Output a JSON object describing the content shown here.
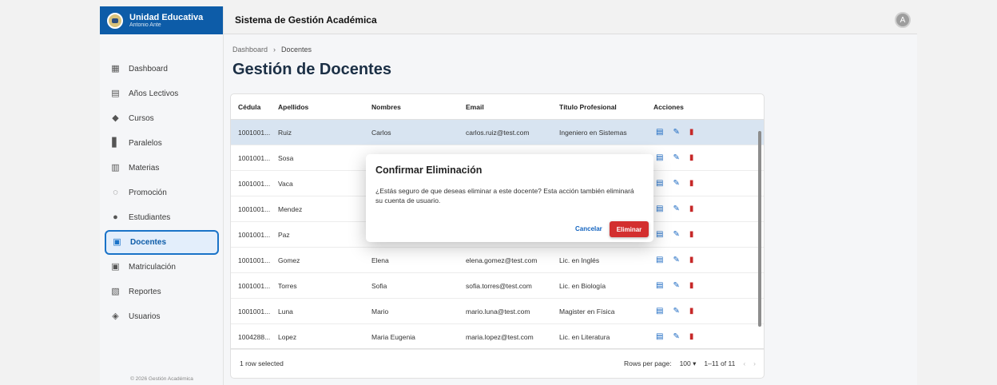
{
  "brand": {
    "title": "Unidad Educativa",
    "subtitle": "Antonio Ante"
  },
  "header": {
    "title": "Sistema de Gestión Académica",
    "avatar_letter": "A"
  },
  "sidebar": {
    "items": [
      {
        "label": "Dashboard",
        "icon": "dashboard-icon",
        "glyph": "▦"
      },
      {
        "label": "Años Lectivos",
        "icon": "calendar-icon",
        "glyph": "▤"
      },
      {
        "label": "Cursos",
        "icon": "school-icon",
        "glyph": "◆"
      },
      {
        "label": "Paralelos",
        "icon": "class-icon",
        "glyph": "▋"
      },
      {
        "label": "Materias",
        "icon": "book-icon",
        "glyph": "▥"
      },
      {
        "label": "Promoción",
        "icon": "promotion-icon",
        "glyph": "◌"
      },
      {
        "label": "Estudiantes",
        "icon": "person-icon",
        "glyph": "●"
      },
      {
        "label": "Docentes",
        "icon": "teacher-icon",
        "glyph": "▣",
        "active": true
      },
      {
        "label": "Matriculación",
        "icon": "badge-icon",
        "glyph": "▣"
      },
      {
        "label": "Reportes",
        "icon": "chart-icon",
        "glyph": "▧"
      },
      {
        "label": "Usuarios",
        "icon": "users-icon",
        "glyph": "◈"
      }
    ],
    "footer": "© 2026 Gestión Académica"
  },
  "breadcrumb": {
    "parent": "Dashboard",
    "separator": "›",
    "current": "Docentes"
  },
  "page": {
    "title": "Gestión de Docentes"
  },
  "table": {
    "columns": [
      "Cédula",
      "Apellidos",
      "Nombres",
      "Email",
      "Título Profesional",
      "Acciones"
    ],
    "rows": [
      {
        "cedula": "1001001...",
        "apellidos": "Ruiz",
        "nombres": "Carlos",
        "email": "carlos.ruiz@test.com",
        "titulo": "Ingeniero en Sistemas",
        "selected": true
      },
      {
        "cedula": "1001001...",
        "apellidos": "Sosa",
        "nombres": "",
        "email": "",
        "titulo": ""
      },
      {
        "cedula": "1001001...",
        "apellidos": "Vaca",
        "nombres": "",
        "email": "",
        "titulo": ""
      },
      {
        "cedula": "1001001...",
        "apellidos": "Mendez",
        "nombres": "",
        "email": "",
        "titulo": ""
      },
      {
        "cedula": "1001001...",
        "apellidos": "Paz",
        "nombres": "",
        "email": "",
        "titulo": ""
      },
      {
        "cedula": "1001001...",
        "apellidos": "Gomez",
        "nombres": "Elena",
        "email": "elena.gomez@test.com",
        "titulo": "Lic. en Inglés"
      },
      {
        "cedula": "1001001...",
        "apellidos": "Torres",
        "nombres": "Sofia",
        "email": "sofia.torres@test.com",
        "titulo": "Lic. en Biología"
      },
      {
        "cedula": "1001001...",
        "apellidos": "Luna",
        "nombres": "Mario",
        "email": "mario.luna@test.com",
        "titulo": "Magister en Física"
      },
      {
        "cedula": "1004288...",
        "apellidos": "Lopez",
        "nombres": "Maria Eugenia",
        "email": "maria.lopez@test.com",
        "titulo": "Lic. en Literatura"
      }
    ],
    "footer": {
      "selected": "1 row selected",
      "rows_per_page_label": "Rows per page:",
      "rows_per_page": "100 ▾",
      "range": "1–11 of 11",
      "prev": "‹",
      "next": "›"
    }
  },
  "dialog": {
    "title": "Confirmar Eliminación",
    "message": "¿Estás seguro de que deseas eliminar a este docente? Esta acción también eliminará su cuenta de usuario.",
    "cancel": "Cancelar",
    "confirm": "Eliminar"
  },
  "colors": {
    "primary": "#0d5ca8",
    "accent": "#1565c0",
    "danger": "#d32f2f",
    "selected_row": "#d8e4f1"
  }
}
